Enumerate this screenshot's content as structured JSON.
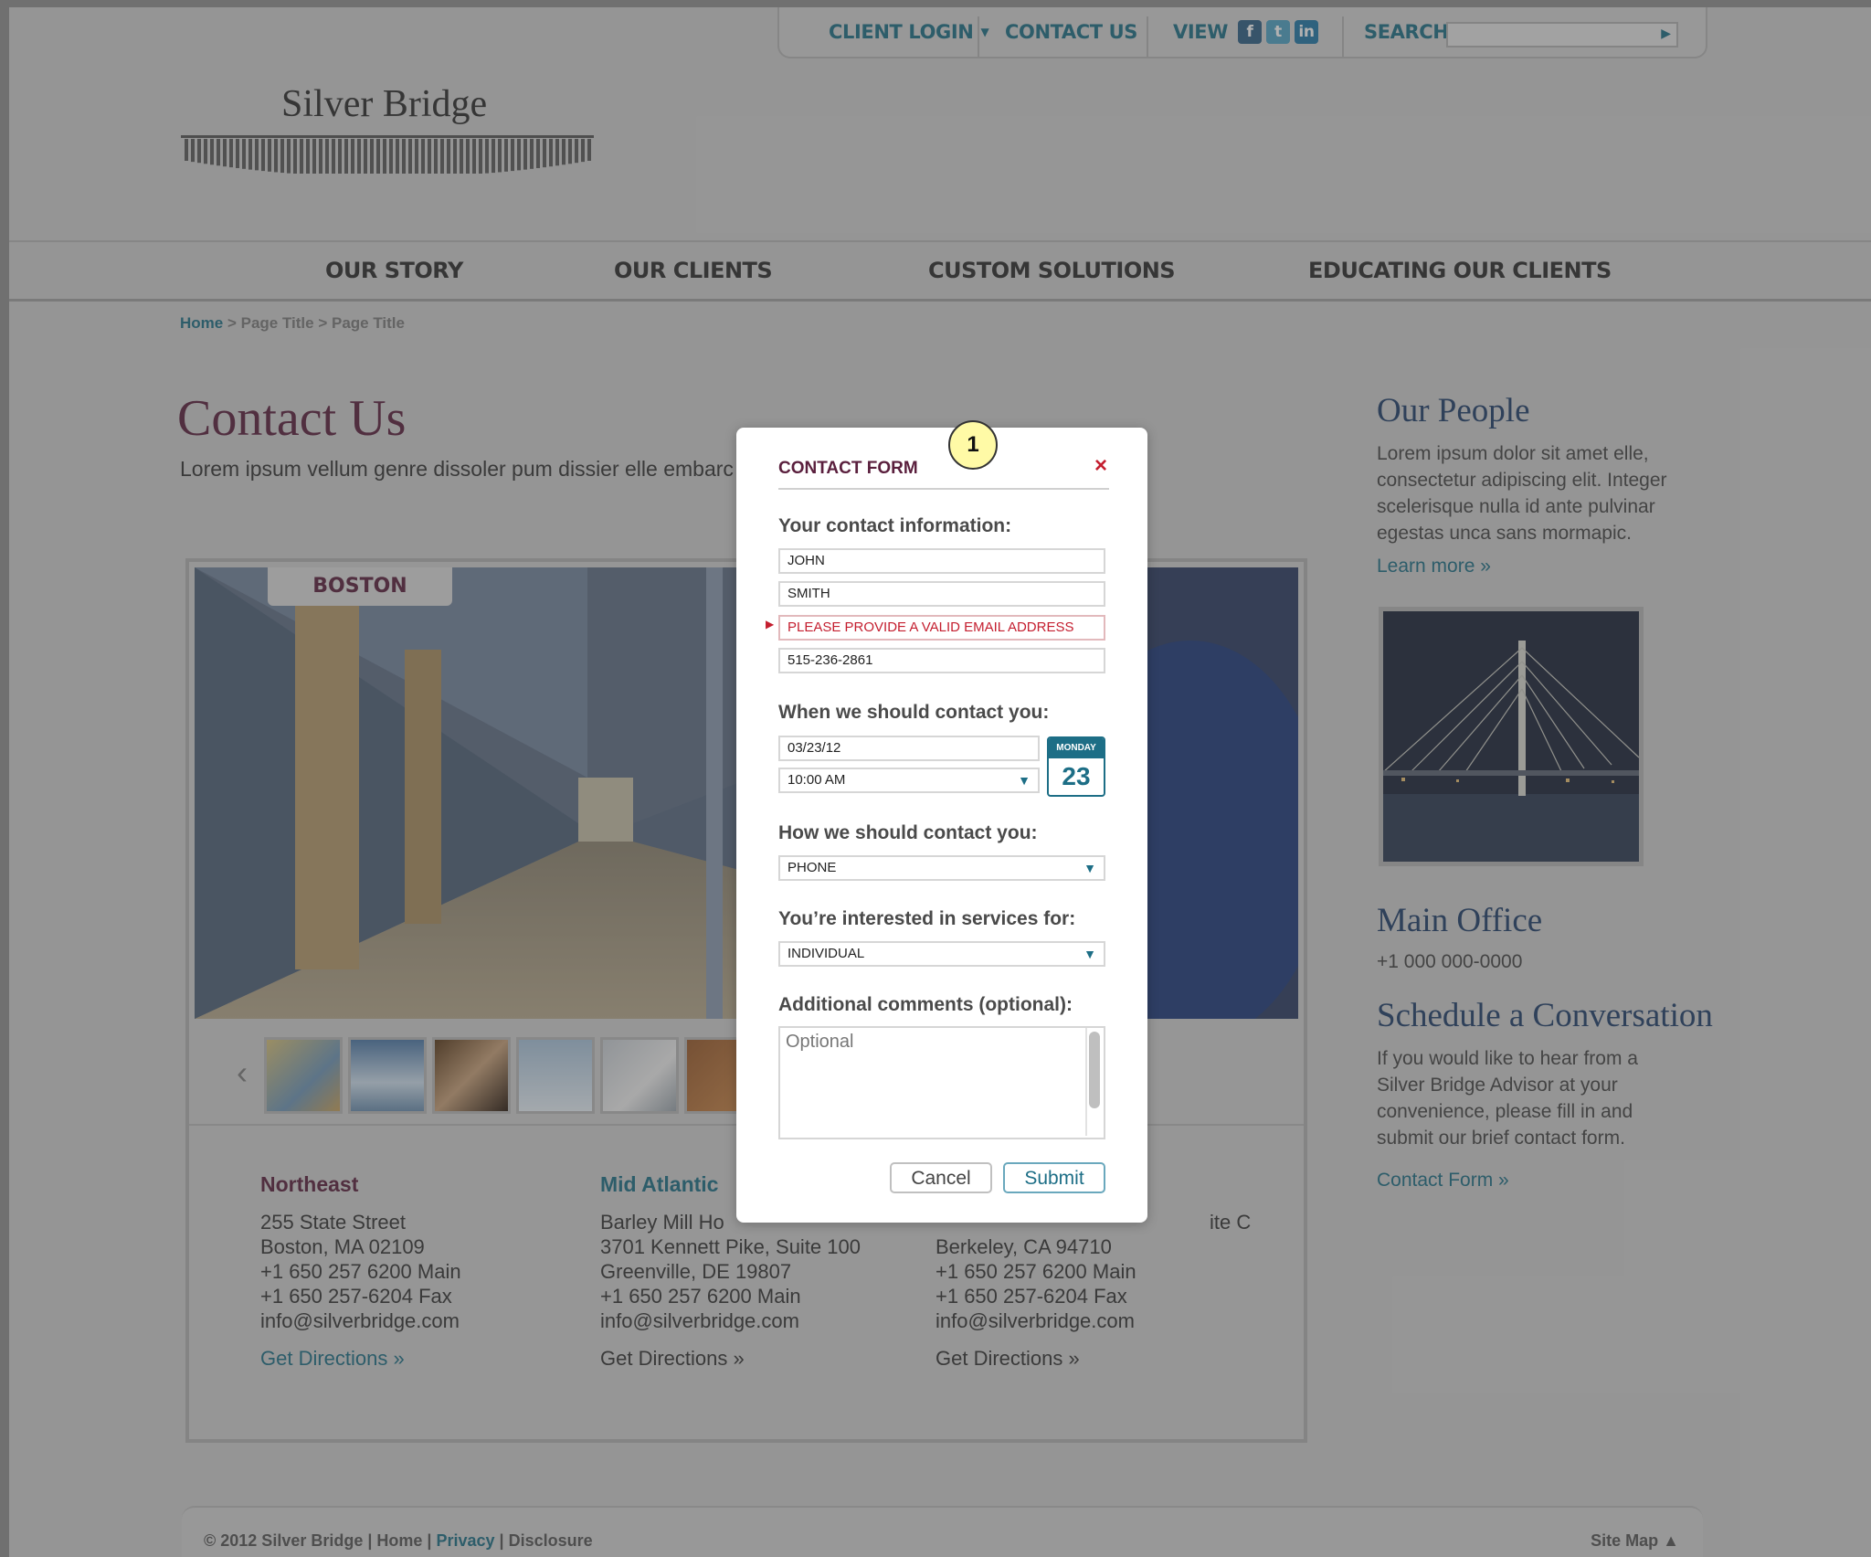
{
  "header": {
    "client_login": "CLIENT LOGIN",
    "contact_us": "CONTACT US",
    "view": "VIEW",
    "social": [
      "f",
      "t",
      "in"
    ],
    "search_label": "SEARCH",
    "logo_text": "Silver Bridge"
  },
  "nav": [
    "OUR STORY",
    "OUR CLIENTS",
    "CUSTOM SOLUTIONS",
    "EDUCATING OUR CLIENTS"
  ],
  "breadcrumb": {
    "home": "Home",
    "sep1": " > ",
    "p1": "Page Title",
    "sep2": " > ",
    "p2": "Page Title"
  },
  "page": {
    "title": "Contact Us",
    "intro": "Lorem ipsum vellum genre dissoler pum dissier elle embarc"
  },
  "gallery": {
    "tab": "BOSTON",
    "offices": [
      {
        "region": "Northeast",
        "lines": [
          "255 State Street",
          "Boston, MA 02109",
          "+1 650 257 6200  Main",
          "+1 650 257-6204  Fax",
          "info@silverbridge.com"
        ],
        "directions": "Get Directions »"
      },
      {
        "region": "Mid Atlantic",
        "lines": [
          "Barley Mill Ho",
          "3701 Kennett Pike, Suite 100",
          "Greenville, DE 19807",
          "+1 650 257 6200  Main",
          "info@silverbridge.com"
        ],
        "directions": "Get Directions »"
      },
      {
        "region": "",
        "lines": [
          "ite C",
          "Berkeley, CA 94710",
          "+1 650 257 6200  Main",
          "+1 650 257-6204  Fax",
          "info@silverbridge.com"
        ],
        "directions": "Get Directions »"
      }
    ]
  },
  "sidebar": {
    "people_title": "Our People",
    "people_text": "Lorem ipsum dolor sit amet elle, consectetur adipiscing elit. Integer scelerisque nulla id ante pulvinar egestas unca sans mormapic.",
    "people_link": "Learn more »",
    "office_title": "Main Office",
    "office_phone": "+1 000 000-0000",
    "schedule_title": "Schedule a Conversation",
    "schedule_text": "If you would like to hear from a Silver Bridge Advisor at your convenience, please fill in and submit our brief contact form.",
    "schedule_link": "Contact Form »"
  },
  "footer": {
    "copyright": "© 2012 Silver Bridge",
    "sep": " | ",
    "home": "Home",
    "privacy": "Privacy",
    "disclosure": "Disclosure",
    "sitemap": "Site Map ▲"
  },
  "modal": {
    "callout": "1",
    "title": "CONTACT FORM",
    "close": "×",
    "section_contact": "Your contact information:",
    "first_name": "JOHN",
    "last_name": "SMITH",
    "email_error": "PLEASE PROVIDE A VALID EMAIL ADDRESS",
    "phone": "515-236-2861",
    "section_when": "When we should contact you:",
    "date": "03/23/12",
    "time": "10:00 AM",
    "cal_day": "MONDAY",
    "cal_num": "23",
    "section_how": "How we should contact you:",
    "how_value": "PHONE",
    "section_services": "You’re interested in services for:",
    "services_value": "INDIVIDUAL",
    "section_comments": "Additional comments (optional):",
    "comments_placeholder": "Optional",
    "cancel": "Cancel",
    "submit": "Submit"
  }
}
